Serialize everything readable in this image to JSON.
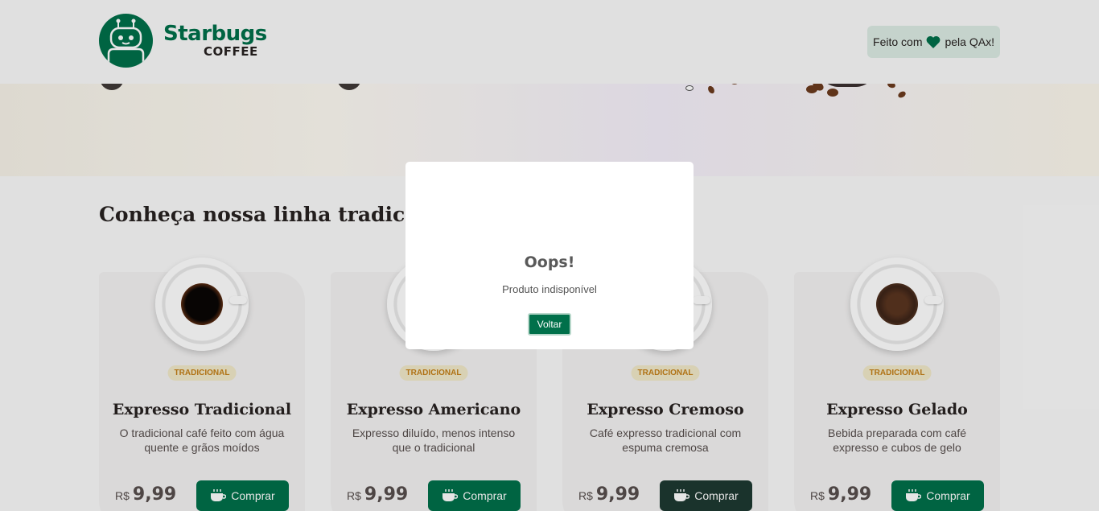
{
  "header": {
    "logo_title": "Starbugs",
    "logo_subtitle": "COFFEE",
    "made_with_prefix": "Feito com",
    "made_with_suffix": "pela QAx!",
    "heart_icon": "heart-icon"
  },
  "main": {
    "section_title": "Conheça nossa linha tradicional",
    "currency": "R$",
    "buy_label": "Comprar",
    "products": [
      {
        "tag": "TRADICIONAL",
        "name": "Expresso Tradicional",
        "description": "O tradicional café feito com água quente e grãos moídos",
        "price": "9,99"
      },
      {
        "tag": "TRADICIONAL",
        "name": "Expresso Americano",
        "description": "Expresso diluído, menos intenso que o tradicional",
        "price": "9,99"
      },
      {
        "tag": "TRADICIONAL",
        "name": "Expresso Cremoso",
        "description": "Café expresso tradicional com espuma cremosa",
        "price": "9,99"
      },
      {
        "tag": "TRADICIONAL",
        "name": "Expresso Gelado",
        "description": "Bebida preparada com café expresso e cubos de gelo",
        "price": "9,99"
      }
    ]
  },
  "modal": {
    "title": "Oops!",
    "message": "Produto indisponível",
    "button_label": "Voltar"
  },
  "colors": {
    "brand_green": "#00704a",
    "dark_green": "#1e3932",
    "tag_bg": "#f1e9c9",
    "tag_text": "#c47f17"
  }
}
